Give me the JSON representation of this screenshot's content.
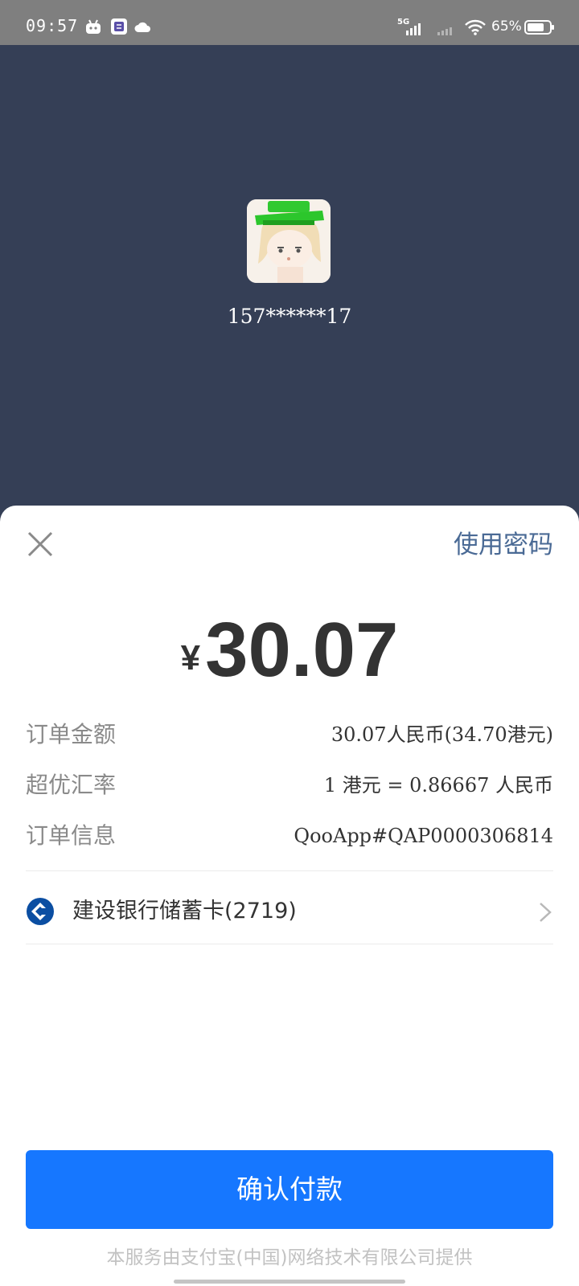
{
  "status_bar": {
    "time": "09:57",
    "icons": [
      "robot-icon",
      "notification-app-icon",
      "cloud-icon"
    ],
    "network": "5G",
    "battery": "65%"
  },
  "header": {
    "account": "157******17",
    "avatar_icon": "user-avatar"
  },
  "sheet": {
    "use_password": "使用密码",
    "currency_symbol": "¥",
    "amount": "30.07",
    "details": [
      {
        "label": "订单金额",
        "value": "30.07人民币(34.70港元)"
      },
      {
        "label": "超优汇率",
        "value": "1 港元 = 0.86667 人民币"
      },
      {
        "label": "订单信息",
        "value": "QooApp#QAP0000306814"
      }
    ],
    "bank": {
      "label": "建设银行储蓄卡(2719)",
      "icon": "ccb-bank-icon"
    },
    "confirm_label": "确认付款",
    "footer": "本服务由支付宝(中国)网络技术有限公司提供"
  },
  "colors": {
    "header_bg": "#353f56",
    "accent_blue": "#1677ff",
    "link_blue": "#4a6a95",
    "bank_blue": "#0b4ea2"
  }
}
